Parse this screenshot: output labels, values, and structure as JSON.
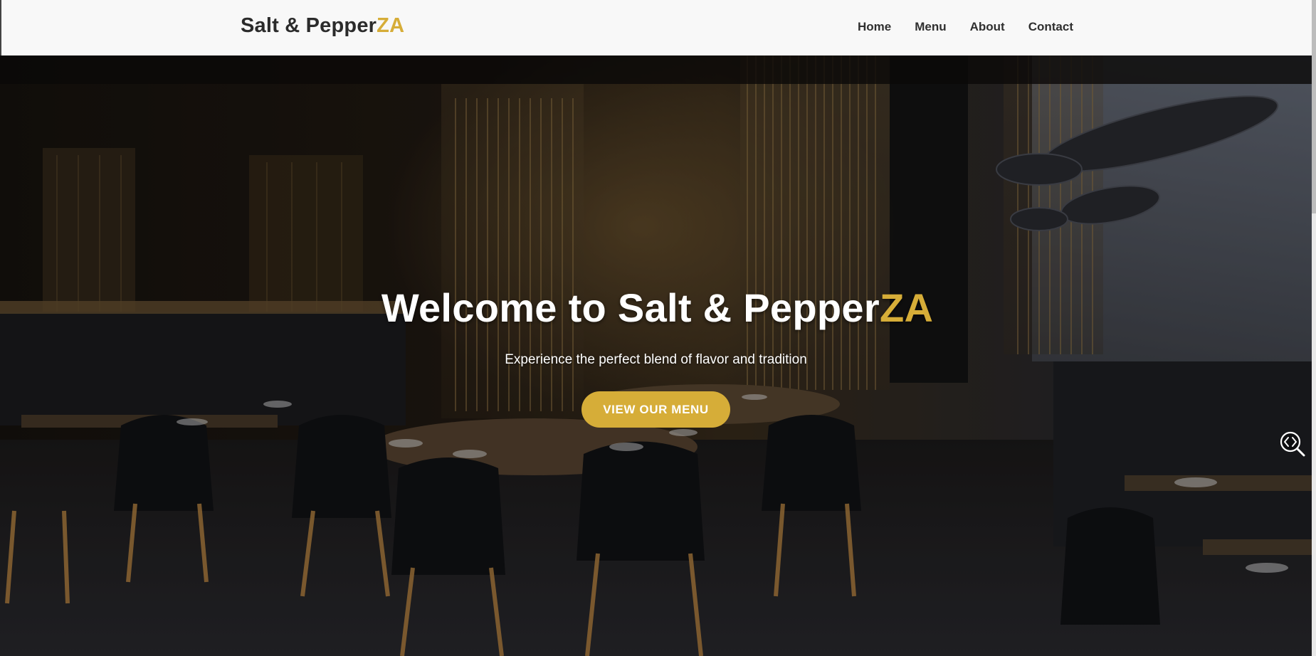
{
  "nav": {
    "brand_main": "Salt & Pepper",
    "brand_accent": "ZA",
    "links": [
      "Home",
      "Menu",
      "About",
      "Contact"
    ]
  },
  "hero": {
    "title_main": "Welcome to Salt & Pepper",
    "title_accent": "ZA",
    "subtitle": "Experience the perfect blend of flavor and tradition",
    "button_label": "VIEW OUR MENU",
    "background_image": "restaurant-interior-photo"
  },
  "icons": {
    "zoom_widget": "zoom-code-icon"
  },
  "colors": {
    "accent": "#d6ad38",
    "navbar_bg": "#f8f8f8",
    "brand_text": "#2b2b2b"
  }
}
